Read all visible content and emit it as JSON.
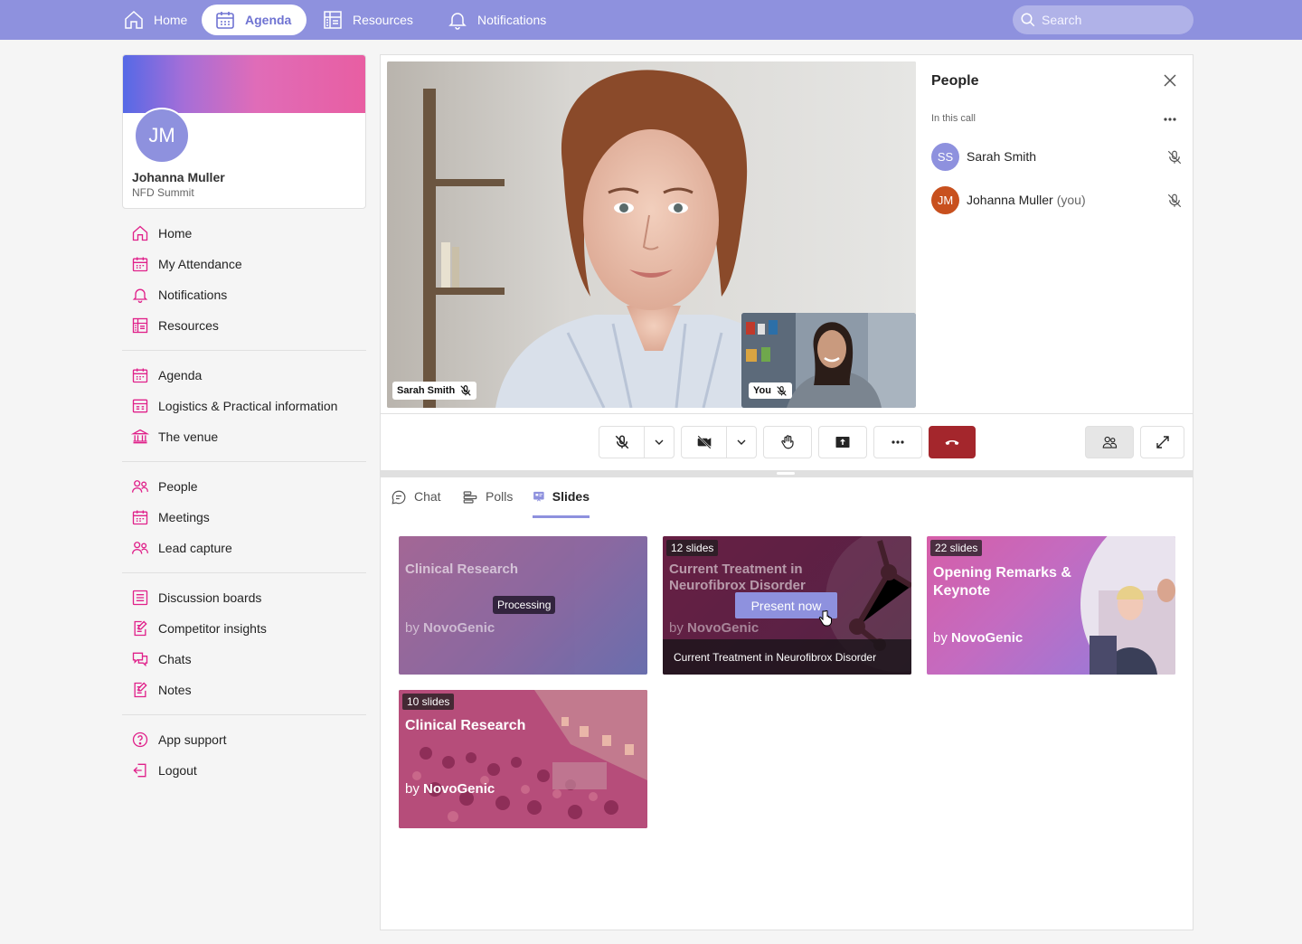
{
  "topnav": {
    "items": [
      {
        "label": "Home",
        "icon": "home-icon"
      },
      {
        "label": "Agenda",
        "icon": "calendar-icon",
        "active": true
      },
      {
        "label": "Resources",
        "icon": "resources-icon"
      },
      {
        "label": "Notifications",
        "icon": "bell-icon"
      }
    ],
    "search_placeholder": "Search"
  },
  "profile": {
    "initials": "JM",
    "name": "Johanna Muller",
    "event": "NFD Summit"
  },
  "sidebar": {
    "groups": [
      [
        {
          "label": "Home",
          "icon": "home-icon"
        },
        {
          "label": "My Attendance",
          "icon": "calendar-icon"
        },
        {
          "label": "Notifications",
          "icon": "bell-icon"
        },
        {
          "label": "Resources",
          "icon": "resources-icon"
        }
      ],
      [
        {
          "label": "Agenda",
          "icon": "calendar-icon"
        },
        {
          "label": "Logistics & Practical information",
          "icon": "info-board-icon"
        },
        {
          "label": "The venue",
          "icon": "venue-icon"
        }
      ],
      [
        {
          "label": "People",
          "icon": "people-icon"
        },
        {
          "label": "Meetings",
          "icon": "calendar-icon"
        },
        {
          "label": "Lead capture",
          "icon": "people-icon"
        }
      ],
      [
        {
          "label": "Discussion boards",
          "icon": "board-icon"
        },
        {
          "label": "Competitor insights",
          "icon": "note-edit-icon"
        },
        {
          "label": "Chats",
          "icon": "chat-icon"
        },
        {
          "label": "Notes",
          "icon": "note-edit-icon"
        }
      ],
      [
        {
          "label": "App support",
          "icon": "help-icon"
        },
        {
          "label": "Logout",
          "icon": "logout-icon"
        }
      ]
    ]
  },
  "call": {
    "main_participant": "Sarah Smith",
    "self_label": "You"
  },
  "people_panel": {
    "title": "People",
    "section": "In this call",
    "participants": [
      {
        "initials": "SS",
        "name": "Sarah Smith",
        "suffix": "",
        "color": "#8e91de"
      },
      {
        "initials": "JM",
        "name": "Johanna Muller",
        "suffix": "(you)",
        "color": "#c8501e"
      }
    ]
  },
  "tabs": {
    "chat": "Chat",
    "polls": "Polls",
    "slides": "Slides"
  },
  "slides": [
    {
      "badge": "",
      "title": "Clinical Research",
      "by": "by",
      "brand": "NovoGenic",
      "status": "Processing"
    },
    {
      "badge": "12 slides",
      "title": "Current Treatment in Neurofibrox Disorder",
      "by": "by",
      "brand": "NovoGenic",
      "action": "Present now",
      "caption": "Current Treatment in Neurofibrox Disorder"
    },
    {
      "badge": "22 slides",
      "title": "Opening Remarks & Keynote",
      "by": "by",
      "brand": "NovoGenic"
    },
    {
      "badge": "10 slides",
      "title": "Clinical Research",
      "by": "by",
      "brand": "NovoGenic"
    }
  ],
  "colors": {
    "accent": "#8e91de",
    "pink": "#e0218a",
    "end_call": "#a4262c"
  }
}
